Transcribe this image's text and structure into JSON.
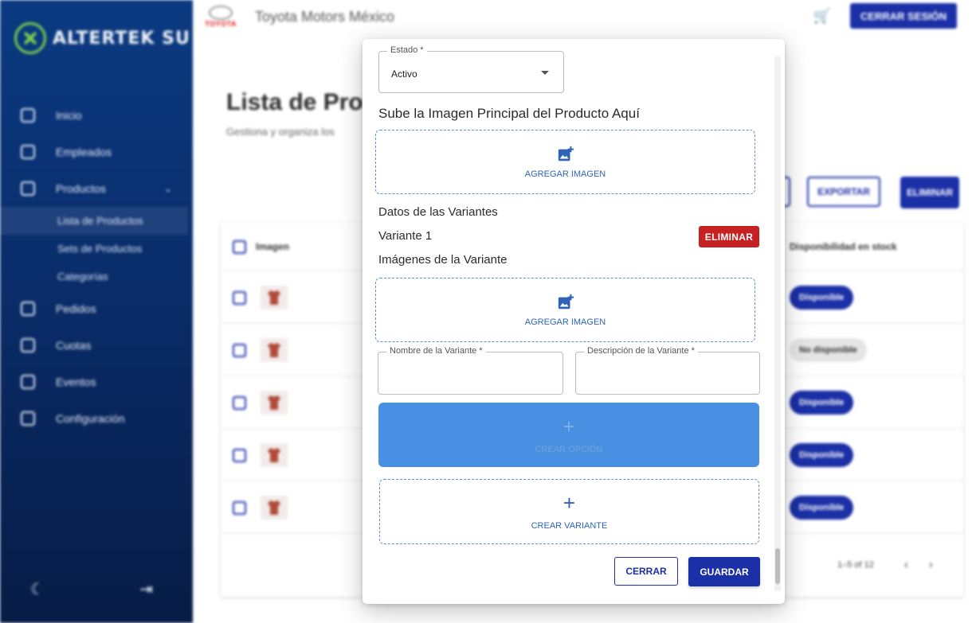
{
  "brand": {
    "name": "ALTERTEK SU",
    "accent": "#7fd14b"
  },
  "sidebar": {
    "items": [
      {
        "label": "Inicio",
        "icon": "home-icon"
      },
      {
        "label": "Empleados",
        "icon": "users-icon"
      },
      {
        "label": "Productos",
        "icon": "box-icon"
      },
      {
        "label": "Pedidos",
        "icon": "inbox-icon"
      },
      {
        "label": "Cuotas",
        "icon": "coins-icon"
      },
      {
        "label": "Eventos",
        "icon": "calendar-icon"
      },
      {
        "label": "Configuración",
        "icon": "gear-icon"
      }
    ],
    "subitems": [
      "Lista de Productos",
      "Sets de Productos",
      "Categorías"
    ],
    "bottom": {
      "theme_icon": "moon-icon",
      "logout_icon": "logout-icon"
    }
  },
  "header": {
    "company_logo_text": "TOYOTA",
    "company": "Toyota Motors México",
    "logout_label": "CERRAR SESIÓN"
  },
  "page": {
    "title": "Lista de Pro",
    "subtitle": "Gestiona y organiza los",
    "export_label": "EXPORTAR",
    "delete_label": "ELIMINAR"
  },
  "table": {
    "col_image": "Imagen",
    "col_stock": "Disponibilidad en stock",
    "rows": [
      {
        "stock": "Disponible"
      },
      {
        "stock": "No disponible"
      },
      {
        "stock": "Disponible"
      },
      {
        "stock": "Disponible"
      },
      {
        "stock": "Disponible"
      }
    ],
    "pagination": "1–5 of 12"
  },
  "modal": {
    "estado_label": "Estado *",
    "estado_value": "Activo",
    "main_image_heading": "Sube la Imagen Principal del Producto Aquí",
    "add_image_label": "AGREGAR IMAGEN",
    "variants_heading": "Datos de las Variantes",
    "variant_title": "Variante 1",
    "variant_delete_label": "ELIMINAR",
    "variant_images_heading": "Imágenes de la Variante",
    "variant_add_image_label": "AGREGAR IMAGEN",
    "variant_name_label": "Nombre de la Variante *",
    "variant_name_value": "",
    "variant_desc_label": "Descripción de la Variante *",
    "variant_desc_value": "",
    "create_option_label": "CREAR OPCIÓN",
    "create_variant_label": "CREAR VARIANTE",
    "close_label": "CERRAR",
    "save_label": "GUARDAR"
  },
  "colors": {
    "primary": "#1b2fa6",
    "danger": "#c62020",
    "option_blue": "#4a90e2",
    "sidebar_top": "#0b3a82"
  }
}
